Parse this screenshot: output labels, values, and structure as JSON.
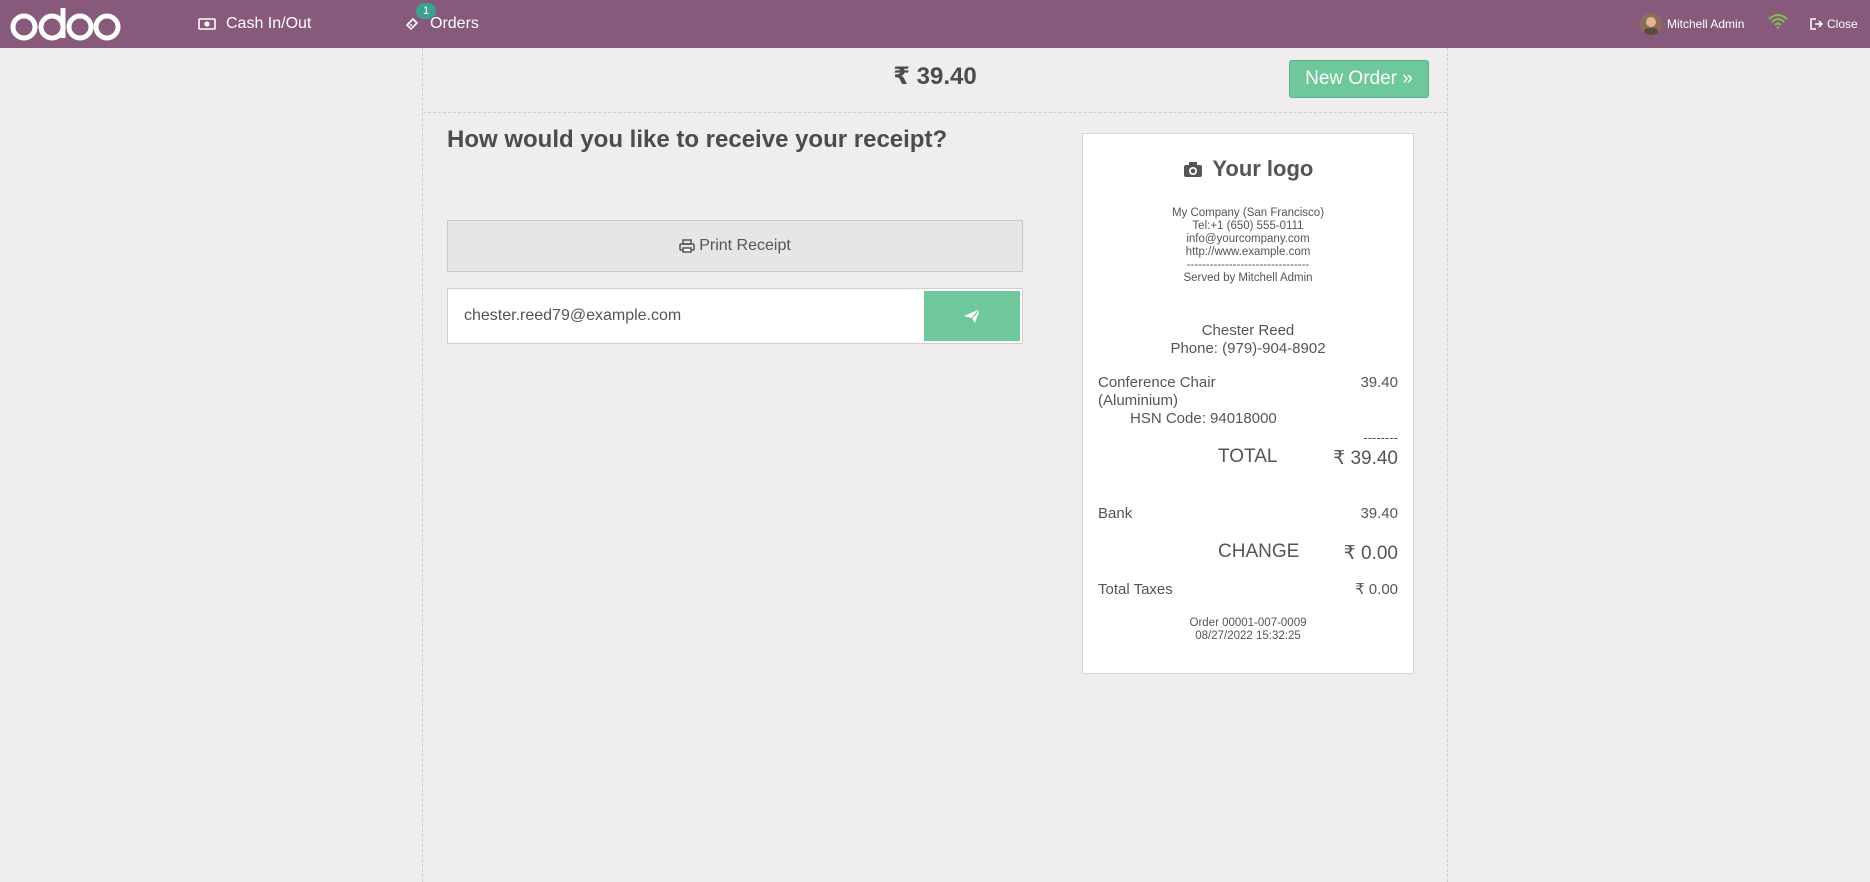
{
  "topbar": {
    "brand": "odoo",
    "cash_label": "Cash In/Out",
    "orders_label": "Orders",
    "orders_badge": "1",
    "user_name": "Mitchell Admin",
    "close_label": "Close"
  },
  "payment": {
    "total": "₹ 39.40",
    "new_order_label": "New Order »"
  },
  "receipt_options": {
    "heading": "How would you like to receive your receipt?",
    "print_label": "Print Receipt",
    "email_value": "chester.reed79@example.com"
  },
  "receipt": {
    "logo_text": "Your logo",
    "company": "My Company (San Francisco)",
    "tel": "Tel:+1 (650) 555-0111",
    "email": "info@yourcompany.com",
    "website": "http://www.example.com",
    "separator": "--------------------------------",
    "served_by": "Served by Mitchell Admin",
    "customer_name": "Chester Reed",
    "customer_phone": "Phone: (979)-904-8902",
    "item_name_1": "Conference Chair",
    "item_name_2": "(Aluminium)",
    "item_price": "39.40",
    "hsn": "HSN Code: 94018000",
    "dashes": "--------",
    "total_label": "TOTAL",
    "total_value": "₹ 39.40",
    "payment_method": "Bank",
    "payment_amount": "39.40",
    "change_label": "CHANGE",
    "change_value": "₹ 0.00",
    "taxes_label": "Total Taxes",
    "taxes_value": "₹ 0.00",
    "order_ref": "Order 00001-007-0009",
    "order_date": "08/27/2022 15:32:25"
  },
  "colors": {
    "topbar": "#875a7b",
    "accent_green": "#6ec89b",
    "badge": "#3fa08e",
    "background": "#efeded"
  }
}
